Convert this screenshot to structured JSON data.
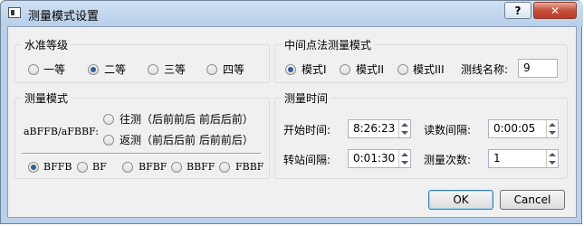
{
  "window": {
    "title": "测量模式设置",
    "help_label": "?",
    "close_label": "✕"
  },
  "level_group": {
    "legend": "水准等级",
    "options": [
      "一等",
      "二等",
      "三等",
      "四等"
    ],
    "selected": "二等"
  },
  "middle_group": {
    "legend": "中间点法测量模式",
    "options": [
      "模式I",
      "模式II",
      "模式III"
    ],
    "selected": "模式I",
    "line_name_label": "测线名称:",
    "line_name_value": "9"
  },
  "mode_group": {
    "legend": "测量模式",
    "pattern_label": "aBFFB/aFBBF:",
    "direction_options": [
      "往测（后前前后 前后后前）",
      "返测（前后后前 后前前后）"
    ],
    "pattern_options": [
      "BFFB",
      "BF",
      "BFBF",
      "BBFF",
      "FBBF"
    ],
    "selected_pattern": "BFFB"
  },
  "time_group": {
    "legend": "测量时间",
    "start_label": "开始时间:",
    "start_value": "8:26:23",
    "read_interval_label": "读数间隔:",
    "read_interval_value": "0:00:05",
    "station_interval_label": "转站间隔:",
    "station_interval_value": "0:01:30",
    "count_label": "测量次数:",
    "count_value": "1"
  },
  "buttons": {
    "ok": "OK",
    "cancel": "Cancel"
  }
}
